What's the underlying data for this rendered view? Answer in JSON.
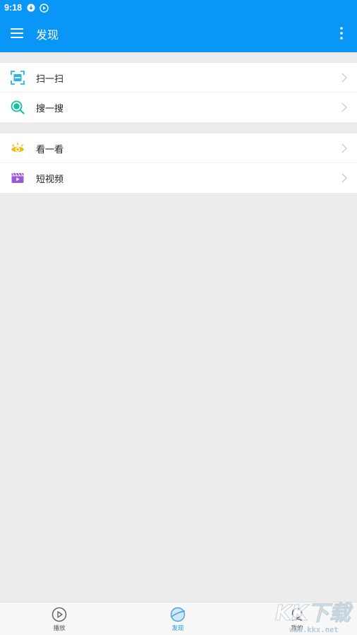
{
  "status_bar": {
    "time": "9:18"
  },
  "app_bar": {
    "title": "发现"
  },
  "groups": [
    {
      "items": [
        {
          "label": "扫一扫",
          "icon": "scan-icon"
        },
        {
          "label": "搜一搜",
          "icon": "search-icon"
        }
      ]
    },
    {
      "items": [
        {
          "label": "看一看",
          "icon": "eye-icon"
        },
        {
          "label": "短视频",
          "icon": "clapperboard-icon"
        }
      ]
    }
  ],
  "bottom_nav": {
    "items": [
      {
        "label": "播放",
        "icon": "play-circle-icon",
        "active": false
      },
      {
        "label": "发现",
        "icon": "planet-icon",
        "active": true
      },
      {
        "label": "我的",
        "icon": "user-icon",
        "active": false
      }
    ]
  },
  "watermark": {
    "text": "KK下载",
    "url": "www.kkx.net"
  },
  "colors": {
    "primary": "#0a96f7",
    "background": "#ececec",
    "scan": "#2bb4e6",
    "search": "#14c1a5",
    "eye": "#f5b800",
    "video": "#9b59d6"
  }
}
